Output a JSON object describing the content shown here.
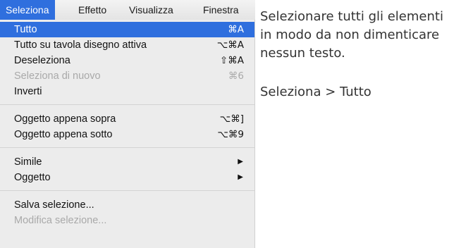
{
  "menubar": {
    "items": [
      {
        "label": "Seleziona",
        "active": true
      },
      {
        "label": "Effetto",
        "active": false
      },
      {
        "label": "Visualizza",
        "active": false
      },
      {
        "label": "Finestra",
        "active": false
      }
    ]
  },
  "menu": {
    "items": [
      {
        "label": "Tutto",
        "shortcut": "⌘A",
        "state": "selected"
      },
      {
        "label": "Tutto su tavola disegno attiva",
        "shortcut": "⌥⌘A",
        "state": "enabled"
      },
      {
        "label": "Deseleziona",
        "shortcut": "⇧⌘A",
        "state": "enabled"
      },
      {
        "label": "Seleziona di nuovo",
        "shortcut": "⌘6",
        "state": "disabled"
      },
      {
        "label": "Inverti",
        "shortcut": "",
        "state": "enabled"
      },
      {
        "label": "Oggetto appena sopra",
        "shortcut": "⌥⌘]",
        "state": "enabled"
      },
      {
        "label": "Oggetto appena sotto",
        "shortcut": "⌥⌘9",
        "state": "enabled"
      },
      {
        "label": "Simile",
        "submenu_icon": "right-triangle-icon",
        "state": "enabled"
      },
      {
        "label": "Oggetto",
        "submenu_icon": "right-triangle-icon",
        "state": "enabled"
      },
      {
        "label": "Salva selezione...",
        "shortcut": "",
        "state": "enabled"
      },
      {
        "label": "Modifica selezione...",
        "shortcut": "",
        "state": "disabled"
      }
    ]
  },
  "caption": {
    "lines": [
      "Selezionare tutti gli elementi",
      "in modo da non dimenticare",
      "nessun testo."
    ],
    "path": "Seleziona > Tutto"
  },
  "colors": {
    "highlight": "#2f6fde",
    "menu_background": "#ececec",
    "disabled_text": "#a9a9a9"
  }
}
